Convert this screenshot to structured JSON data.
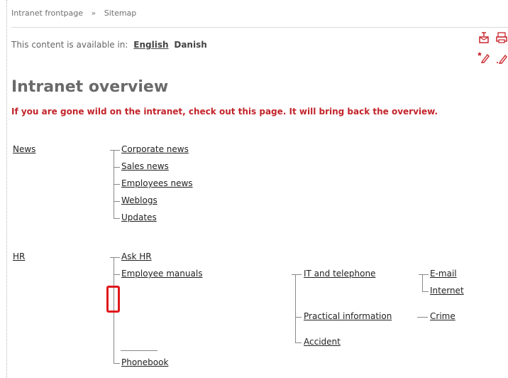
{
  "breadcrumb": {
    "items": [
      "Intranet frontpage",
      "Sitemap"
    ],
    "separator": "»"
  },
  "availability": {
    "prefix": "This content is available in:",
    "languages": [
      "English",
      "Danish"
    ],
    "active": "English"
  },
  "toolbar": {
    "icons": [
      "send-page-icon",
      "print-icon",
      "add-edit-icon",
      "edit-icon"
    ]
  },
  "page": {
    "title": "Intranet overview",
    "intro": "If you are gone wild on the intranet, check out this page. It will bring back the overview."
  },
  "sitemap": {
    "news": {
      "label": "News",
      "children": [
        "Corporate news",
        "Sales news",
        "Employees news",
        "Weblogs",
        "Updates"
      ]
    },
    "hr": {
      "label": "HR",
      "children": [
        "Ask HR",
        "Employee manuals",
        "Phonebook"
      ],
      "manuals_children": [
        "IT and telephone",
        "Practical information",
        "Accident"
      ],
      "it_children": [
        "E-mail",
        "Internet"
      ],
      "practical_children": [
        "Crime"
      ]
    }
  },
  "colors": {
    "title": "#6a6a6a",
    "intro": "#c2242a",
    "highlight": "#e0191c"
  }
}
